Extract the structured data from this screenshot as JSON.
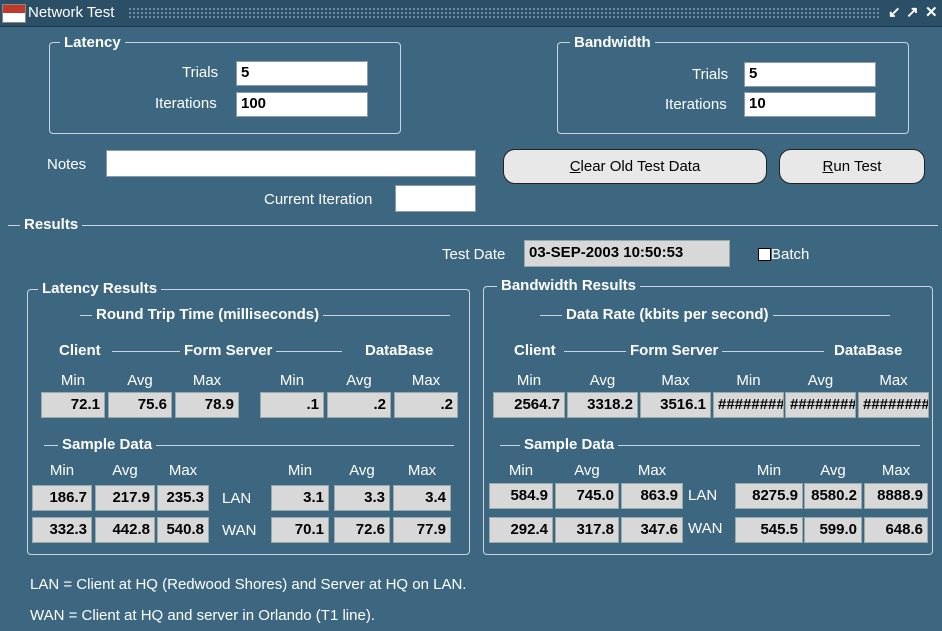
{
  "window": {
    "title": "Network Test",
    "app_icon_text": "ORACLE",
    "controls": [
      "↙",
      "↗",
      "✕"
    ]
  },
  "latency": {
    "label": "Latency",
    "trials_label": "Trials",
    "trials_value": "5",
    "iterations_label": "Iterations",
    "iterations_value": "100"
  },
  "bandwidth": {
    "label": "Bandwidth",
    "trials_label": "Trials",
    "trials_value": "5",
    "iterations_label": "Iterations",
    "iterations_value": "10"
  },
  "notes": {
    "label": "Notes",
    "value": ""
  },
  "current_iteration": {
    "label": "Current Iteration",
    "value": ""
  },
  "buttons": {
    "clear_prefix": "C",
    "clear_rest": "lear Old Test Data",
    "run_prefix": "R",
    "run_rest": "un Test"
  },
  "results": {
    "label": "Results",
    "test_date_label": "Test Date",
    "test_date_value": "03-SEP-2003 10:50:53",
    "batch_label": "Batch"
  },
  "latency_results": {
    "label": "Latency Results",
    "header": "Round Trip Time (milliseconds)",
    "groups": [
      "Client",
      "Form Server",
      "DataBase"
    ],
    "cols": [
      "Min",
      "Avg",
      "Max",
      "Min",
      "Avg",
      "Max"
    ],
    "values": [
      "72.1",
      "75.6",
      "78.9",
      ".1",
      ".2",
      ".2"
    ],
    "sample_label": "Sample Data",
    "sample_cols": [
      "Min",
      "Avg",
      "Max",
      "Min",
      "Avg",
      "Max"
    ],
    "lan_label": "LAN",
    "wan_label": "WAN",
    "lan_values": [
      "186.7",
      "217.9",
      "235.3",
      "3.1",
      "3.3",
      "3.4"
    ],
    "wan_values": [
      "332.3",
      "442.8",
      "540.8",
      "70.1",
      "72.6",
      "77.9"
    ]
  },
  "bandwidth_results": {
    "label": "Bandwidth Results",
    "header": "Data Rate (kbits per second)",
    "groups": [
      "Client",
      "Form Server",
      "DataBase"
    ],
    "cols": [
      "Min",
      "Avg",
      "Max",
      "Min",
      "Avg",
      "Max"
    ],
    "values": [
      "2564.7",
      "3318.2",
      "3516.1",
      "########",
      "########",
      "########"
    ],
    "sample_label": "Sample Data",
    "sample_cols": [
      "Min",
      "Avg",
      "Max",
      "Min",
      "Avg",
      "Max"
    ],
    "lan_label": "LAN",
    "wan_label": "WAN",
    "lan_values": [
      "584.9",
      "745.0",
      "863.9",
      "8275.9",
      "8580.2",
      "8888.9"
    ],
    "wan_values": [
      "292.4",
      "317.8",
      "347.6",
      "545.5",
      "599.0",
      "648.6"
    ]
  },
  "footnotes": [
    "LAN = Client at HQ (Redwood Shores) and Server at HQ on LAN.",
    "WAN = Client at HQ and server in Orlando (T1 line)."
  ]
}
